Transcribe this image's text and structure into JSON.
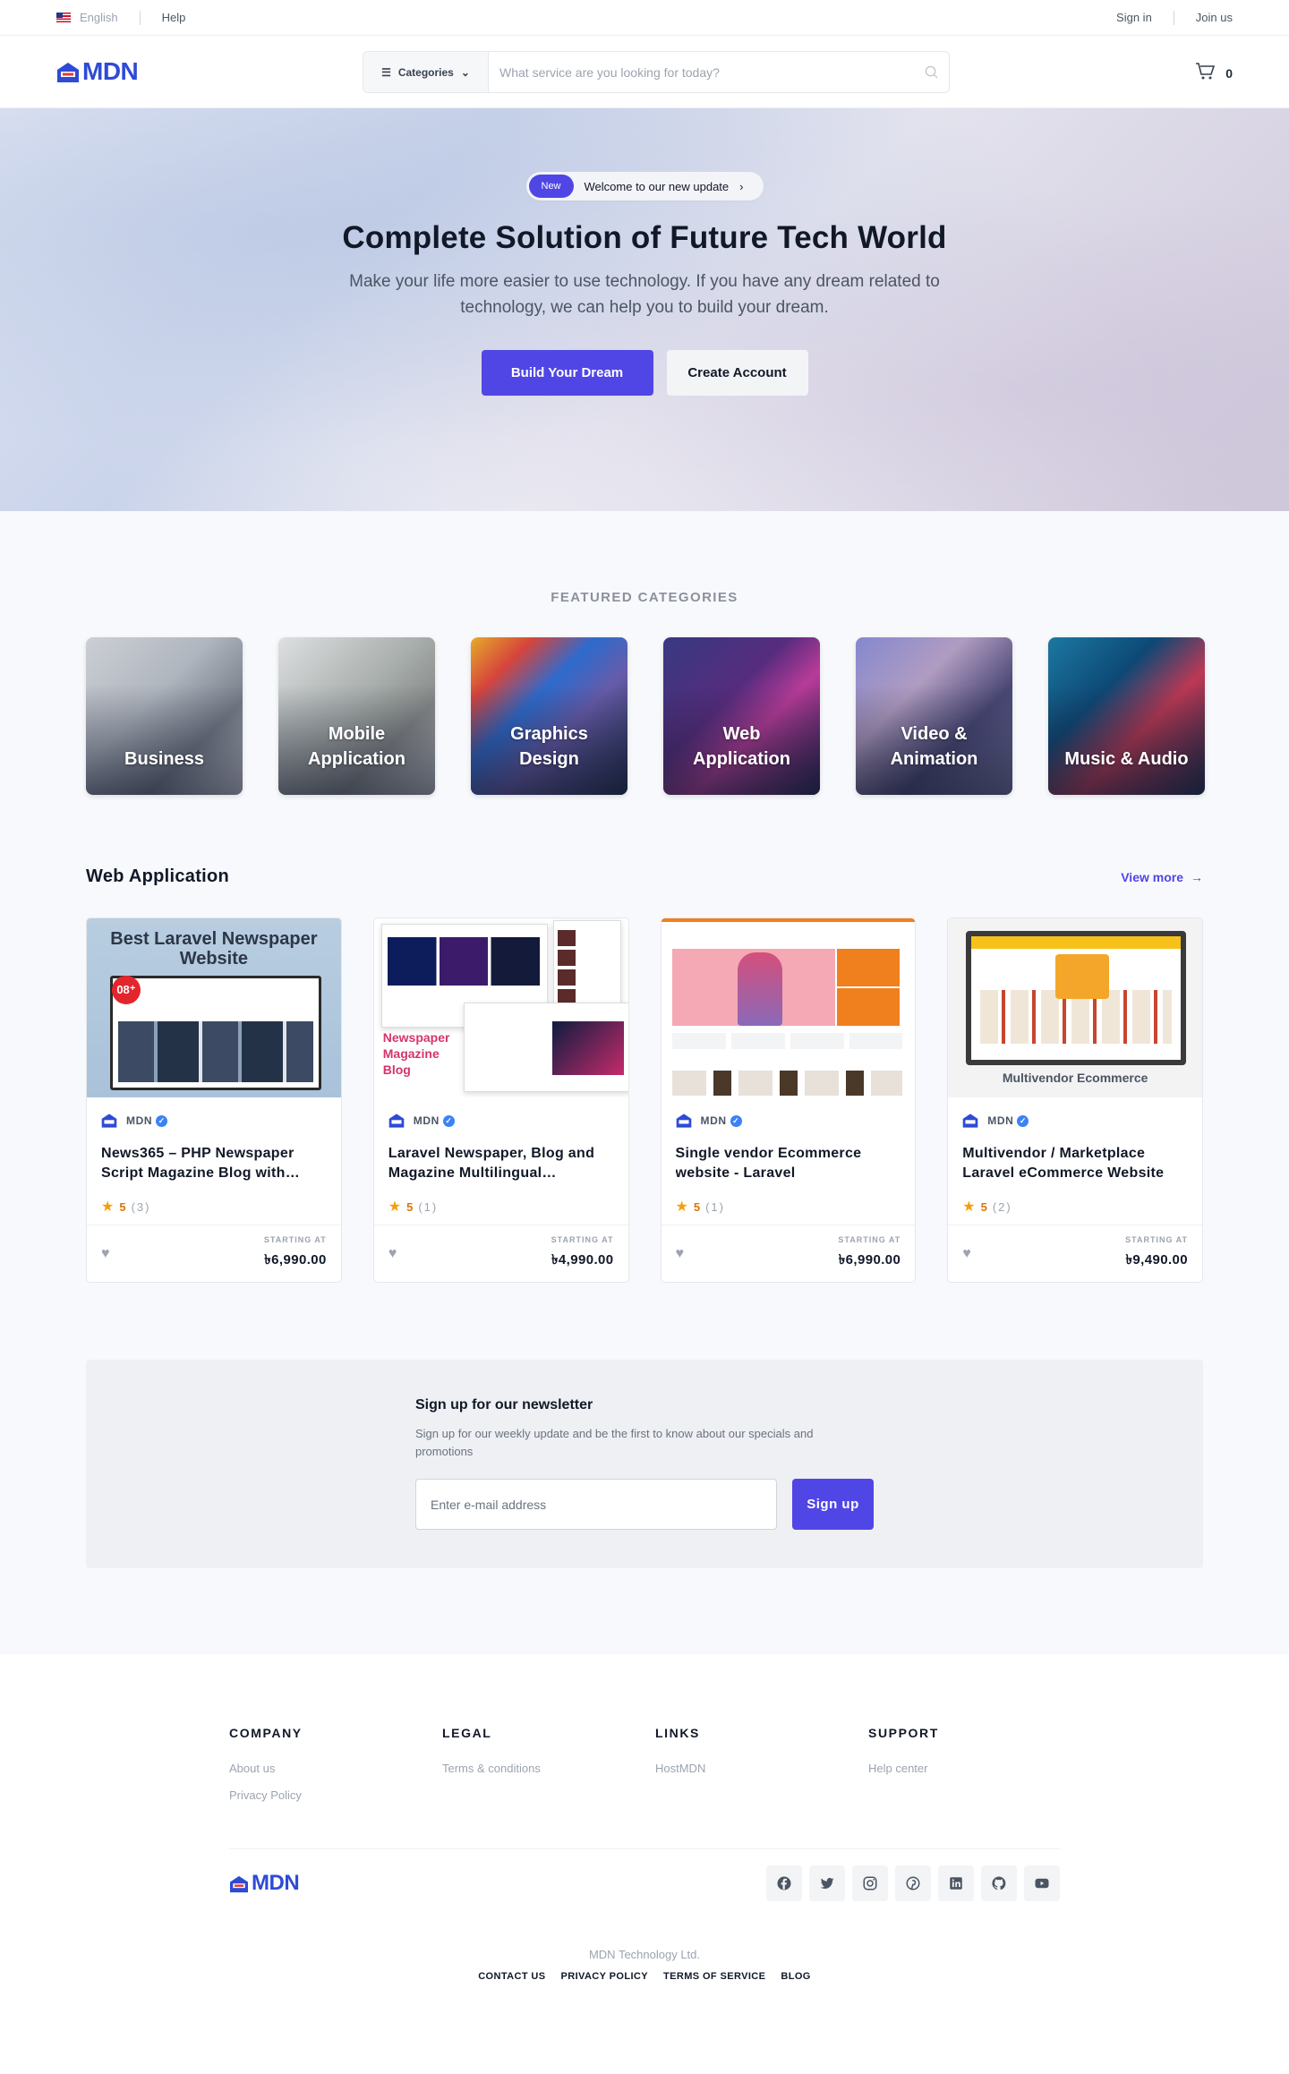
{
  "topbar": {
    "language": "English",
    "help": "Help",
    "signin": "Sign in",
    "join": "Join us"
  },
  "header": {
    "logo": "MDN",
    "categories_label": "Categories",
    "search_placeholder": "What service are you looking for today?",
    "cart_count": "0"
  },
  "hero": {
    "badge": "New",
    "badge_text": "Welcome to our new update",
    "title": "Complete Solution of Future Tech World",
    "subtitle": "Make your life more easier to use technology. If you have any dream related to technology, we can help you to build your dream.",
    "primary_button": "Build Your Dream",
    "secondary_button": "Create Account"
  },
  "featured": {
    "heading": "FEATURED CATEGORIES",
    "categories": [
      {
        "label": "Business"
      },
      {
        "label": "Mobile Application"
      },
      {
        "label": "Graphics Design"
      },
      {
        "label": "Web Application"
      },
      {
        "label": "Video & Animation"
      },
      {
        "label": "Music & Audio"
      }
    ]
  },
  "webapp": {
    "heading": "Web Application",
    "view_more": "View more",
    "products": [
      {
        "thumb_title": "Best Laravel Newspaper Website",
        "thumb_badge": "08⁺",
        "vendor": "MDN",
        "title": "News365 – PHP Newspaper Script Magazine Blog with…",
        "rating": "5",
        "reviews": "(3)",
        "starting": "STARTING AT",
        "price": "৳6,990.00"
      },
      {
        "thumb_title": "Newspaper Magazine Blog",
        "vendor": "MDN",
        "title": "Laravel Newspaper, Blog and Magazine Multilingual…",
        "rating": "5",
        "reviews": "(1)",
        "starting": "STARTING AT",
        "price": "৳4,990.00"
      },
      {
        "vendor": "MDN",
        "title": "Single vendor Ecommerce website - Laravel",
        "rating": "5",
        "reviews": "(1)",
        "starting": "STARTING AT",
        "price": "৳6,990.00"
      },
      {
        "thumb_title": "Multivendor Ecommerce",
        "vendor": "MDN",
        "title": "Multivendor / Marketplace Laravel eCommerce Website",
        "rating": "5",
        "reviews": "(2)",
        "starting": "STARTING AT",
        "price": "৳9,490.00"
      }
    ]
  },
  "newsletter": {
    "title": "Sign up for our newsletter",
    "text": "Sign up for our weekly update and be the first to know about our specials and promotions",
    "placeholder": "Enter e-mail address",
    "button": "Sign up"
  },
  "footer": {
    "columns": [
      {
        "heading": "COMPANY",
        "links": [
          "About us",
          "Privacy Policy"
        ]
      },
      {
        "heading": "LEGAL",
        "links": [
          "Terms & conditions"
        ]
      },
      {
        "heading": "LINKS",
        "links": [
          "HostMDN"
        ]
      },
      {
        "heading": "SUPPORT",
        "links": [
          "Help center"
        ]
      }
    ],
    "logo": "MDN",
    "copyright": "MDN Technology Ltd.",
    "bottom_links": [
      "CONTACT US",
      "PRIVACY POLICY",
      "TERMS OF SERVICE",
      "BLOG"
    ],
    "socials": [
      "facebook-icon",
      "twitter-icon",
      "instagram-icon",
      "pinterest-icon",
      "linkedin-icon",
      "github-icon",
      "youtube-icon"
    ]
  },
  "colors": {
    "brand": "#2e4bd6",
    "accent": "#5046e5",
    "star": "#f59e0b"
  }
}
